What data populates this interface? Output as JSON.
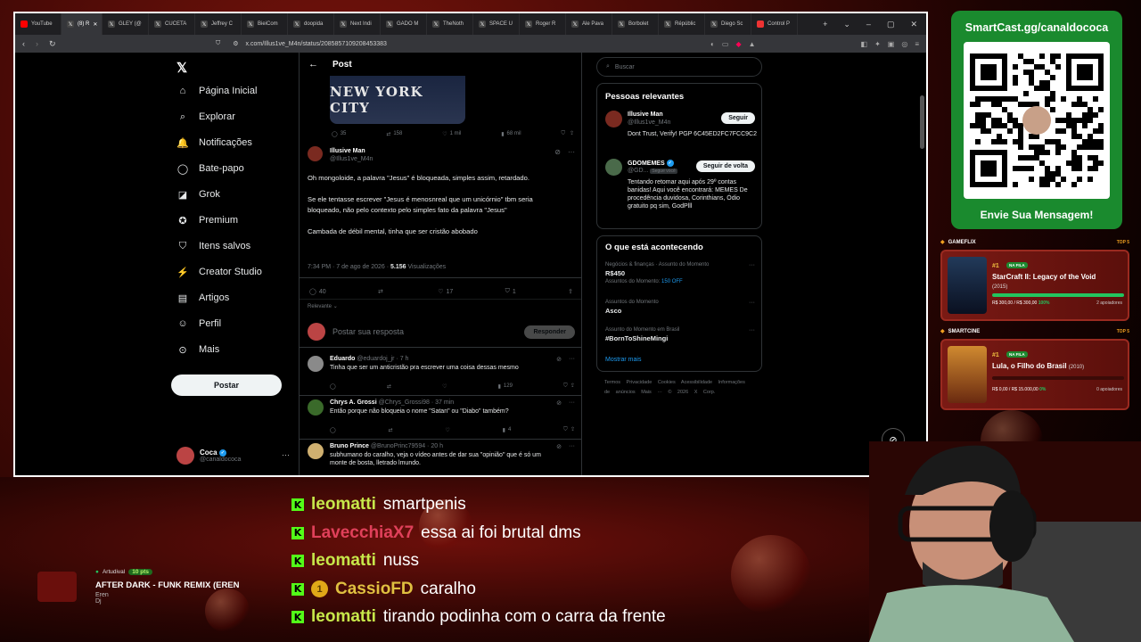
{
  "browser": {
    "tabs": [
      {
        "label": "YouTube",
        "active": false,
        "icon": "youtube-icon",
        "color": "#ff0000"
      },
      {
        "label": "(8) R",
        "active": true,
        "icon": "x-icon"
      },
      {
        "label": "GLEY (@",
        "active": false,
        "icon": "x-icon"
      },
      {
        "label": "CUCETA",
        "active": false,
        "icon": "x-icon"
      },
      {
        "label": "Jeffrey C",
        "active": false,
        "icon": "x-icon"
      },
      {
        "label": "BieiCom",
        "active": false,
        "icon": "x-icon"
      },
      {
        "label": "doopida",
        "active": false,
        "icon": "x-icon"
      },
      {
        "label": "Next Indi",
        "active": false,
        "icon": "x-icon"
      },
      {
        "label": "GADO M",
        "active": false,
        "icon": "x-icon"
      },
      {
        "label": "TheNoth",
        "active": false,
        "icon": "x-icon"
      },
      {
        "label": "SPACE U",
        "active": false,
        "icon": "x-icon"
      },
      {
        "label": "Roger R",
        "active": false,
        "icon": "x-icon"
      },
      {
        "label": "Ale Pava",
        "active": false,
        "icon": "x-icon"
      },
      {
        "label": "Borbolet",
        "active": false,
        "icon": "x-icon"
      },
      {
        "label": "Répúblic",
        "active": false,
        "icon": "x-icon"
      },
      {
        "label": "Diego Sc",
        "active": false,
        "icon": "x-icon"
      },
      {
        "label": "Control P",
        "active": false,
        "icon": "control-icon",
        "color": "#e33"
      }
    ],
    "url": "x.com/Illus1ve_M4n/status/2085857109208453383"
  },
  "nav": {
    "items": [
      {
        "label": "Página Inicial",
        "icon": "home-icon",
        "glyph": "⌂"
      },
      {
        "label": "Explorar",
        "icon": "search-icon",
        "glyph": "⌕"
      },
      {
        "label": "Notificações",
        "icon": "bell-icon",
        "glyph": "🔔"
      },
      {
        "label": "Bate-papo",
        "icon": "chat-icon",
        "glyph": "◯"
      },
      {
        "label": "Grok",
        "icon": "grok-icon",
        "glyph": "◪"
      },
      {
        "label": "Premium",
        "icon": "premium-icon",
        "glyph": "✪"
      },
      {
        "label": "Itens salvos",
        "icon": "bookmark-icon",
        "glyph": "⛉"
      },
      {
        "label": "Creator Studio",
        "icon": "creator-icon",
        "glyph": "⚡"
      },
      {
        "label": "Artigos",
        "icon": "article-icon",
        "glyph": "▤"
      },
      {
        "label": "Perfil",
        "icon": "profile-icon",
        "glyph": "☺"
      },
      {
        "label": "Mais",
        "icon": "more-icon",
        "glyph": "⊙"
      }
    ],
    "post_button": "Postar",
    "account": {
      "name": "Coca",
      "handle": "@canaldococa"
    }
  },
  "post": {
    "header": "Post",
    "shirt_text": "NEW YORK CITY",
    "quoted_actions": {
      "replies": "35",
      "reposts": "158",
      "likes": "1 mil",
      "views": "68 mil"
    },
    "author": {
      "name": "Illusive Man",
      "handle": "@Illus1ve_M4n"
    },
    "paragraphs": [
      "Oh mongoloide, a palavra \"Jesus\" é bloqueada, simples assim, retardado.",
      "Se ele tentasse escrever \"Jesus é menosnreal que um unicórnio\" tbm seria bloqueado, não pelo contexto pelo simples fato da palavra \"Jesus\"",
      "Cambada de débil mental, tinha que ser cristão abobado"
    ],
    "meta": "7:34 PM · 7 de ago de 2026 · ",
    "views": "5.156",
    "views_label": " Visualizações",
    "actions": {
      "replies": "40",
      "reposts": "",
      "likes": "17",
      "bookmarks": "1"
    },
    "sort": "Relevante",
    "reply_placeholder": "Postar sua resposta",
    "reply_button": "Responder"
  },
  "comments": [
    {
      "name": "Eduardo",
      "handle": "@eduardoj_jr",
      "time": "7 h",
      "text": "Tinha que ser um anticristão pra escrever uma coisa dessas mesmo",
      "views": "129",
      "replies": "",
      "likes": ""
    },
    {
      "name": "Chrys A. Grossi",
      "handle": "@Chrys_Grossi98",
      "time": "37 min",
      "text": "Então porque não bloqueia o nome \"Satan\" ou \"Diabo\" também?",
      "views": "4",
      "replies": "",
      "likes": ""
    },
    {
      "name": "Bruno Prince",
      "handle": "@BrunoPrinc79594",
      "time": "20 h",
      "text": "subhumano do caralho, veja o vídeo antes de dar sua \"opinião\" que é só um monte de bosta, lletrado lmundo.",
      "views": "",
      "replies": "",
      "likes": ""
    }
  ],
  "right": {
    "search_placeholder": "Buscar",
    "relevant_title": "Pessoas relevantes",
    "people": [
      {
        "name": "Illusive Man",
        "handle": "@Illus1ve_M4n",
        "bio": "Dont Trust, Verify! PGP 6C45ED2FC7FCC9C2",
        "button": "Seguir",
        "follows_you": ""
      },
      {
        "name": "GDOMEMES",
        "handle": "@GD...",
        "bio": "Tentando retomar aqui após 29º contas banidas! Aqui você encontrará: MEMES De procedência duvidosa, Corinthians, Ódio gratuito pq sim, GodPlll",
        "button": "Seguir de volta",
        "follows_you": "Segue você"
      }
    ],
    "trending_title": "O que está acontecendo",
    "trends": [
      {
        "category": "Negócios & finanças · Assunto do Momento",
        "name": "R$450",
        "extra_prefix": "Assuntos do Momento: ",
        "extra_link": "150 OFF"
      },
      {
        "category": "Assuntos do Momento",
        "name": "Asco",
        "extra_prefix": "",
        "extra_link": ""
      },
      {
        "category": "Assunto do Momento em Brasil",
        "name": "#BornToShineMingi",
        "extra_prefix": "",
        "extra_link": ""
      }
    ],
    "show_more": "Mostrar mais",
    "footer": "Termos Privacidade Cookies Acessibilidade Informações de anúncios Mais ··· © 2026 X Corp."
  },
  "smartcast": {
    "title": "SmartCast.gg/canaldococa",
    "message": "Envie Sua Mensagem!",
    "color": "#1a8a2e"
  },
  "gameflix": {
    "section": "GAMEFLIX",
    "top": "TOP 5",
    "rank": "#1",
    "queue": "NA FILA",
    "title": "StarCraft II: Legacy of the Void",
    "year": "(2015)",
    "stats": "R$ 300,00 / R$ 300,00",
    "percent": "100%",
    "progress": 1.0,
    "supporters": "2 apoiadores"
  },
  "smartcine": {
    "section": "SMARTCINE",
    "top": "TOP 5",
    "rank": "#1",
    "queue": "NA FILA",
    "title": "Lula, o Filho do Brasil",
    "year": "(2010)",
    "stats": "R$ 0,00 / R$ 15.000,00",
    "percent": "0%",
    "progress": 0.0,
    "supporters": "0 apoiadores"
  },
  "now_playing": {
    "label": "Artudival",
    "points": "10 pts",
    "song": "AFTER DARK - FUNK REMIX (EREN",
    "artist": "Eren Dj"
  },
  "chat": [
    {
      "user": "leomatti",
      "color": "#c7e84a",
      "text": "smartpenis",
      "badge": "kick"
    },
    {
      "user": "LavecchiaX7",
      "color": "#e0405a",
      "text": "essa ai foi brutal dms",
      "badge": "kick"
    },
    {
      "user": "leomatti",
      "color": "#c7e84a",
      "text": "nuss",
      "badge": "kick"
    },
    {
      "user": "CassioFD",
      "color": "#e0c040",
      "text": "caralho",
      "badge": "kick+1",
      "badge_text": "1"
    },
    {
      "user": "leomatti",
      "color": "#c7e84a",
      "text": "tirando podinha com o carra da frente",
      "badge": "kick"
    }
  ]
}
